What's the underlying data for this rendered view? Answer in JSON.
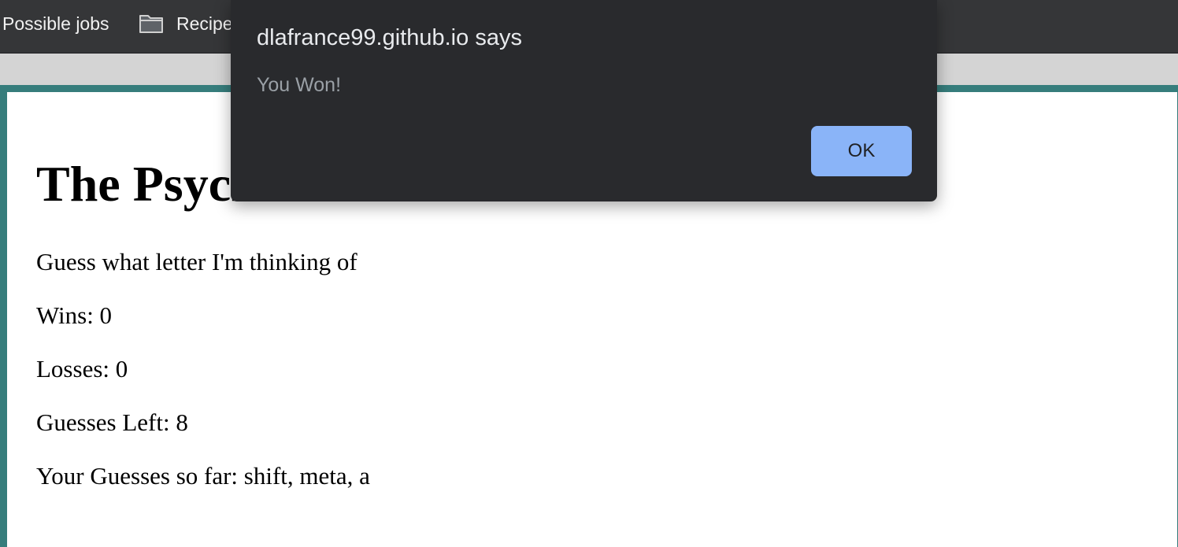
{
  "bookmarks": {
    "items": [
      {
        "label": "Possible jobs"
      },
      {
        "label": "Recipe",
        "icon": "folder-icon"
      }
    ]
  },
  "page": {
    "title": "The Psych",
    "prompt": "Guess what letter I'm thinking of",
    "wins": "Wins: 0",
    "losses": "Losses: 0",
    "guesses_left": "Guesses Left: 8",
    "guesses_so_far": "Your Guesses so far: shift, meta, a"
  },
  "alert": {
    "title": "dlafrance99.github.io says",
    "message": "You Won!",
    "ok_label": "OK"
  },
  "colors": {
    "frame_border": "#367d7c",
    "dialog_bg": "#292a2d",
    "ok_button_bg": "#8ab4f8",
    "bookmarks_bar_bg": "#353638"
  }
}
